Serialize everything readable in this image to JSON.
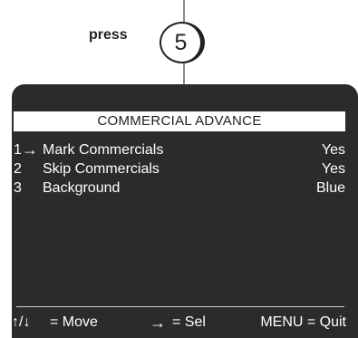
{
  "instruction": {
    "press_label": "press",
    "key_label": "5"
  },
  "osd": {
    "title": "COMMERCIAL ADVANCE",
    "items": [
      {
        "number": "1",
        "cursor": "→",
        "label": "Mark Commercials",
        "value": "Yes",
        "selected": true
      },
      {
        "number": "2",
        "cursor": "",
        "label": "Skip Commercials",
        "value": "Yes",
        "selected": false
      },
      {
        "number": "3",
        "cursor": "",
        "label": "Background",
        "value": "Blue",
        "selected": false
      }
    ],
    "footer": {
      "move_keys": "↑/↓",
      "move_text": "= Move",
      "select_key": "→",
      "select_text": "= Sel",
      "quit_text": "MENU = Quit"
    }
  },
  "colors": {
    "screen_background": "#2b2b2b",
    "title_background": "#ffffff",
    "text_on_screen": "#ffffff",
    "connector_line": "#8a8a8a"
  },
  "icons": {
    "cursor": "right-arrow-icon",
    "move": "up-down-arrows-icon",
    "select": "right-arrow-icon"
  }
}
